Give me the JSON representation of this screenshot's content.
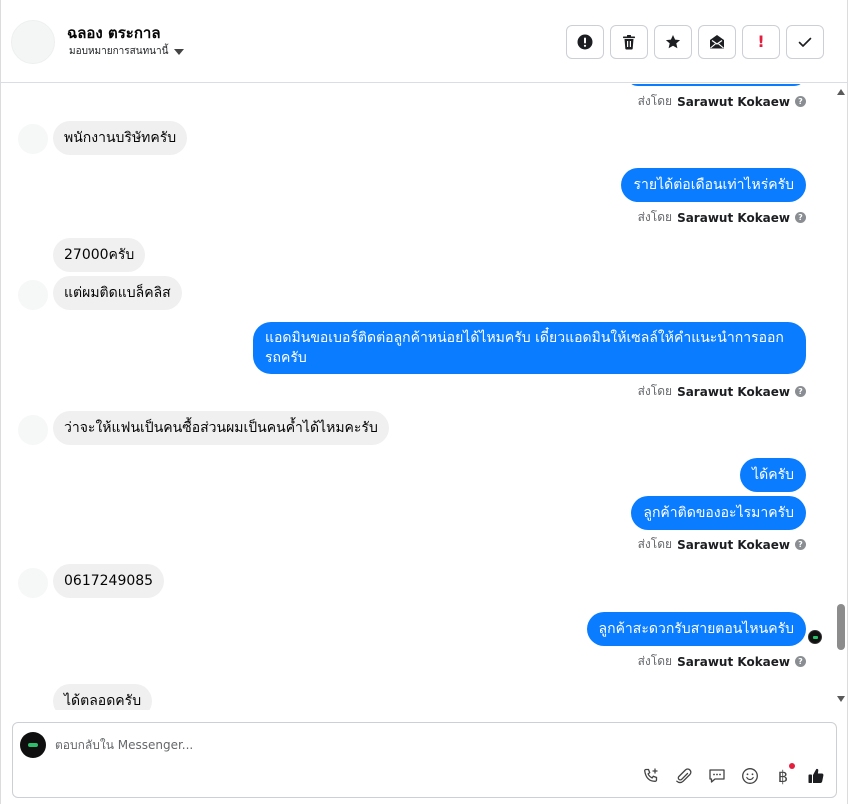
{
  "header": {
    "contact_name": "ฉลอง ตระกาล",
    "assign_label": "มอบหมายการสนทนานี้",
    "actions": [
      {
        "name": "spam-button",
        "icon": "exclamation-circle-icon"
      },
      {
        "name": "delete-button",
        "icon": "trash-icon"
      },
      {
        "name": "star-button",
        "icon": "star-icon"
      },
      {
        "name": "mark-unread-button",
        "icon": "mail-icon"
      },
      {
        "name": "follow-up-button",
        "icon": "exclamation-icon",
        "text": "!"
      },
      {
        "name": "done-button",
        "icon": "check-icon"
      }
    ]
  },
  "messages": [
    {
      "dir": "in",
      "text": "พนักงานบริษัทครับ"
    },
    {
      "dir": "out",
      "text": "รายได้ต่อเดือนเท่าไหร่ครับ"
    },
    {
      "dir": "in",
      "text": "27000ครับ"
    },
    {
      "dir": "in",
      "text": "แต่ผมติดแบล็คลิส"
    },
    {
      "dir": "out",
      "text": "แอดมินขอเบอร์ติดต่อลูกค้าหน่อยได้ไหมครับ เดี๋ยวแอดมินให้เซลล์ให้คำแนะนำการออกรถครับ"
    },
    {
      "dir": "in",
      "text": "ว่าจะให้แฟนเป็นคนซื้อส่วนผมเป็นคนค้ำได้ไหมคะรับ"
    },
    {
      "dir": "out",
      "text": "ได้ครับ"
    },
    {
      "dir": "out",
      "text": "ลูกค้าติดของอะไรมาครับ"
    },
    {
      "dir": "in",
      "text": "0617249085"
    },
    {
      "dir": "out",
      "text": "ลูกค้าสะดวกรับสายตอนไหนครับ"
    },
    {
      "dir": "in",
      "text": "ได้ตลอดครับ"
    }
  ],
  "sent_by": {
    "prefix": "ส่งโดย",
    "agent": "Sarawut Kokaew",
    "help": "?"
  },
  "composer": {
    "placeholder": "ตอบกลับใน Messenger...",
    "tools": [
      {
        "name": "call-tool",
        "icon": "phone-plus-icon"
      },
      {
        "name": "attach-tool",
        "icon": "paperclip-icon"
      },
      {
        "name": "saved-replies-tool",
        "icon": "chat-dots-icon"
      },
      {
        "name": "emoji-tool",
        "icon": "smiley-icon"
      },
      {
        "name": "payment-tool",
        "icon": "baht-icon",
        "text": "฿"
      },
      {
        "name": "like-tool",
        "icon": "thumbs-up-icon"
      }
    ]
  },
  "colors": {
    "outgoing_bubble": "#0a7cff",
    "incoming_bubble": "#f0f0f0",
    "alert": "#e41e3f"
  }
}
